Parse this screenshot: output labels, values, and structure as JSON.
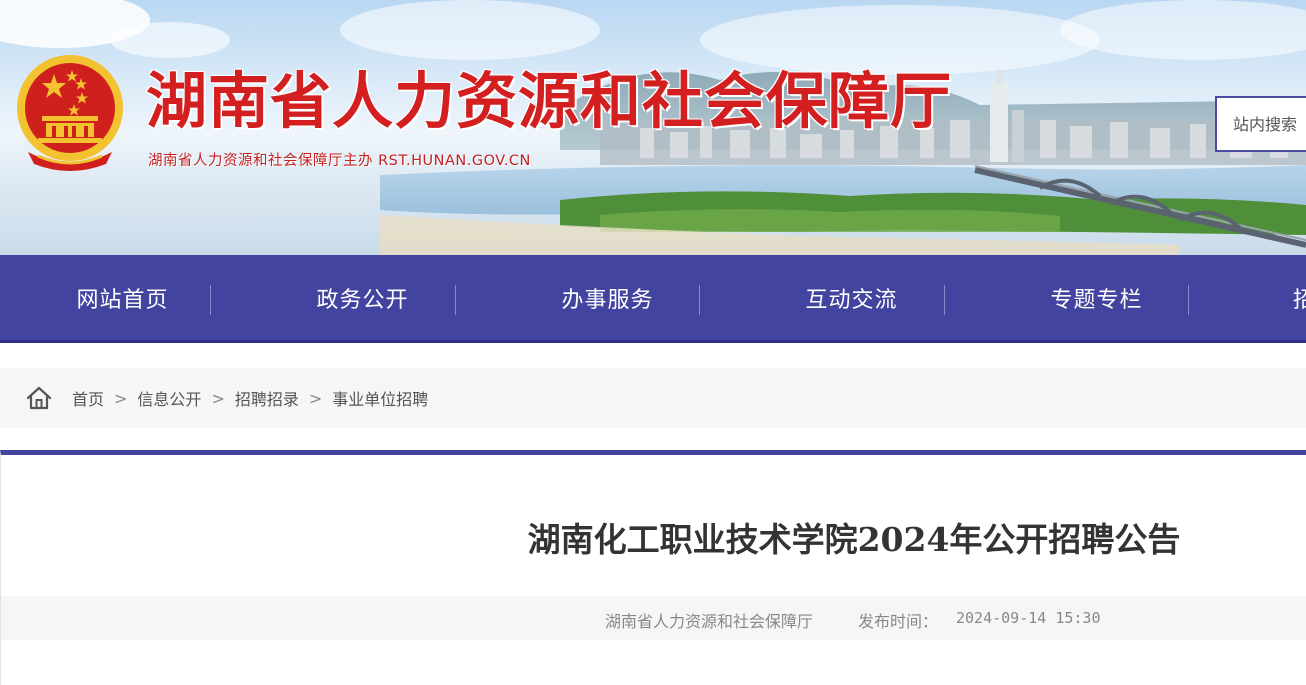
{
  "header": {
    "site_title": "湖南省人力资源和社会保障厅",
    "subtitle": "湖南省人力资源和社会保障厅主办   RST.HUNAN.GOV.CN",
    "search_placeholder": "站内搜索"
  },
  "nav": {
    "items": [
      {
        "label": "网站首页"
      },
      {
        "label": "政务公开"
      },
      {
        "label": "办事服务"
      },
      {
        "label": "互动交流"
      },
      {
        "label": "专题专栏"
      },
      {
        "label": "招"
      }
    ]
  },
  "breadcrumb": {
    "items": [
      "首页",
      "信息公开",
      "招聘招录",
      "事业单位招聘"
    ],
    "separator": ">"
  },
  "article": {
    "title": "湖南化工职业技术学院2024年公开招聘公告",
    "source": "湖南省人力资源和社会保障厅",
    "publish_label": "发布时间：",
    "publish_time": "2024-09-14 15:30"
  },
  "colors": {
    "nav_bg": "#4343a0",
    "title_red": "#d31f1f",
    "emblem_gold": "#f2c230",
    "emblem_red": "#d0201e"
  },
  "icons": [
    "national-emblem-icon",
    "home-icon"
  ]
}
